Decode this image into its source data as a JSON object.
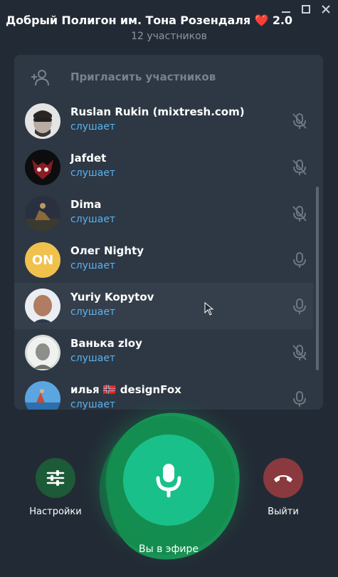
{
  "window": {
    "title": "Добрый Полигон им. Тона Розендаля",
    "title_emoji": "❤️",
    "title_suffix": "2.0",
    "participants_count": "12 участников"
  },
  "invite": {
    "label": "Пригласить участников",
    "icon": "add-user-icon"
  },
  "participants": [
    {
      "name": "Ruslan Rukin (mixtresh.com)",
      "status": "слушает",
      "mic": "muted"
    },
    {
      "name": "Jafdet",
      "status": "слушает",
      "mic": "muted"
    },
    {
      "name": "Dima",
      "status": "слушает",
      "mic": "muted"
    },
    {
      "name": "Олег Nighty",
      "initials": "ON",
      "status": "слушает",
      "mic": "on"
    },
    {
      "name": "Yuriy Kopytov",
      "status": "слушает",
      "mic": "on"
    },
    {
      "name": "Ванька zloy",
      "status": "слушает",
      "mic": "muted"
    },
    {
      "name": "илья",
      "flag": "🇳🇴",
      "name_suffix": "designFox",
      "status": "слушает",
      "mic": "on"
    }
  ],
  "controls": {
    "settings_label": "Настройки",
    "leave_label": "Выйти",
    "main_status": "Вы в эфире"
  },
  "colors": {
    "background": "#222b35",
    "panel": "#2d3844",
    "status_blue": "#5ab2f0",
    "main_button": "#1ac08a",
    "settings_button": "#1d5a38",
    "leave_button": "#8a3a3f",
    "initials_avatar": "#f1c14e"
  }
}
